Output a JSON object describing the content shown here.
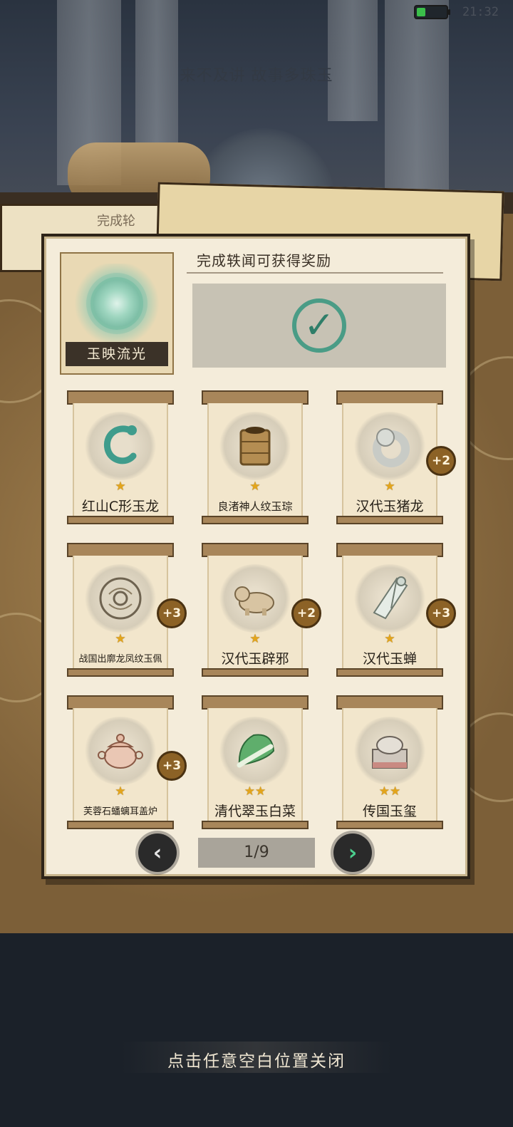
{
  "status_bar": {
    "time": "21:32",
    "battery_level": 0.3
  },
  "background": {
    "caption": "来不及讲 故事多珠玉",
    "tab_label": "完成轮"
  },
  "dialog": {
    "badge": {
      "name": "玉映流光"
    },
    "reward_title": "完成轶闻可获得奖励",
    "reward_status_icon": "check-icon",
    "items": [
      {
        "name": "红山C形玉龙",
        "stars": 1,
        "bonus": ""
      },
      {
        "name": "良渚神人纹玉琮",
        "stars": 1,
        "bonus": ""
      },
      {
        "name": "汉代玉猪龙",
        "stars": 1,
        "bonus": "+2"
      },
      {
        "name": "战国出廓龙凤纹玉佩",
        "stars": 1,
        "bonus": "+3"
      },
      {
        "name": "汉代玉辟邪",
        "stars": 1,
        "bonus": "+2"
      },
      {
        "name": "汉代玉蝉",
        "stars": 1,
        "bonus": "+3"
      },
      {
        "name": "芙蓉石蟠螭耳盖炉",
        "stars": 1,
        "bonus": "+3"
      },
      {
        "name": "清代翠玉白菜",
        "stars": 2,
        "bonus": ""
      },
      {
        "name": "传国玉玺",
        "stars": 2,
        "bonus": ""
      }
    ],
    "pagination": {
      "page": "1/9",
      "prev_icon": "chevron-left-icon",
      "next_icon": "chevron-right-icon"
    }
  },
  "close_hint": "点击任意空白位置关闭"
}
